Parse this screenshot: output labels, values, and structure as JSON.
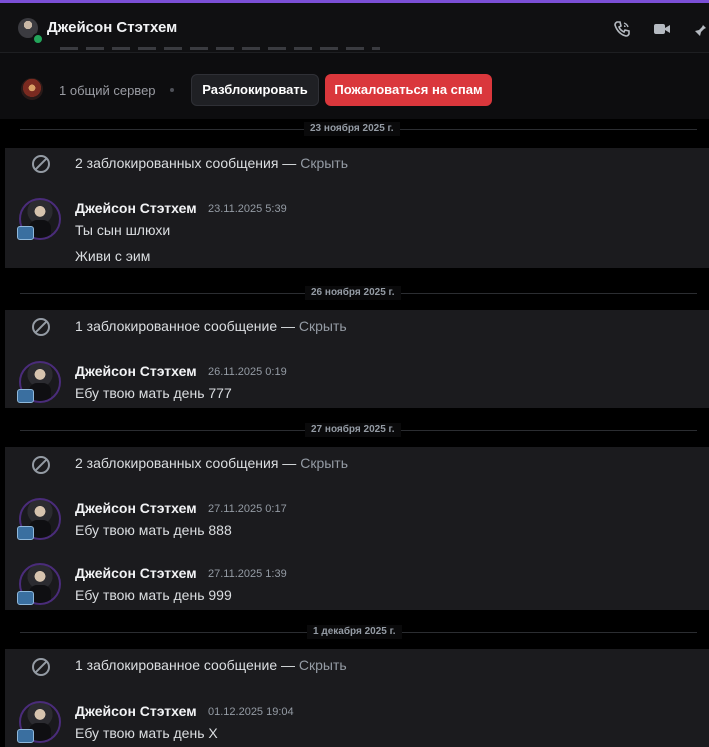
{
  "header": {
    "title": "Джейсон Стэтхем"
  },
  "profile_strip": {
    "server_count": "1 общий сервер",
    "unblock_label": "Разблокировать",
    "spam_label": "Пожаловаться на спам"
  },
  "dates": [
    "23 ноября 2025 г.",
    "26 ноября 2025 г.",
    "27 ноября 2025 г.",
    "1 декабря 2025 г."
  ],
  "blocked": [
    {
      "text": "2 заблокированных сообщения — ",
      "hide": "Скрыть"
    },
    {
      "text": "1 заблокированное сообщение — ",
      "hide": "Скрыть"
    },
    {
      "text": "2 заблокированных сообщения — ",
      "hide": "Скрыть"
    },
    {
      "text": "1 заблокированное сообщение — ",
      "hide": "Скрыть"
    }
  ],
  "messages": [
    {
      "author": "Джейсон Стэтхем",
      "time": "23.11.2025 5:39",
      "lines": [
        "Ты сын шлюхи",
        "Живи с эим"
      ]
    },
    {
      "author": "Джейсон Стэтхем",
      "time": "26.11.2025 0:19",
      "lines": [
        "Ебу твою мать день 777"
      ]
    },
    {
      "author": "Джейсон Стэтхем",
      "time": "27.11.2025 0:17",
      "lines": [
        "Ебу твою мать день 888"
      ]
    },
    {
      "author": "Джейсон Стэтхем",
      "time": "27.11.2025 1:39",
      "lines": [
        "Ебу твою мать день 999"
      ]
    },
    {
      "author": "Джейсон Стэтхем",
      "time": "01.12.2025 19:04",
      "lines": [
        "Ебу твою мать день X"
      ]
    }
  ]
}
